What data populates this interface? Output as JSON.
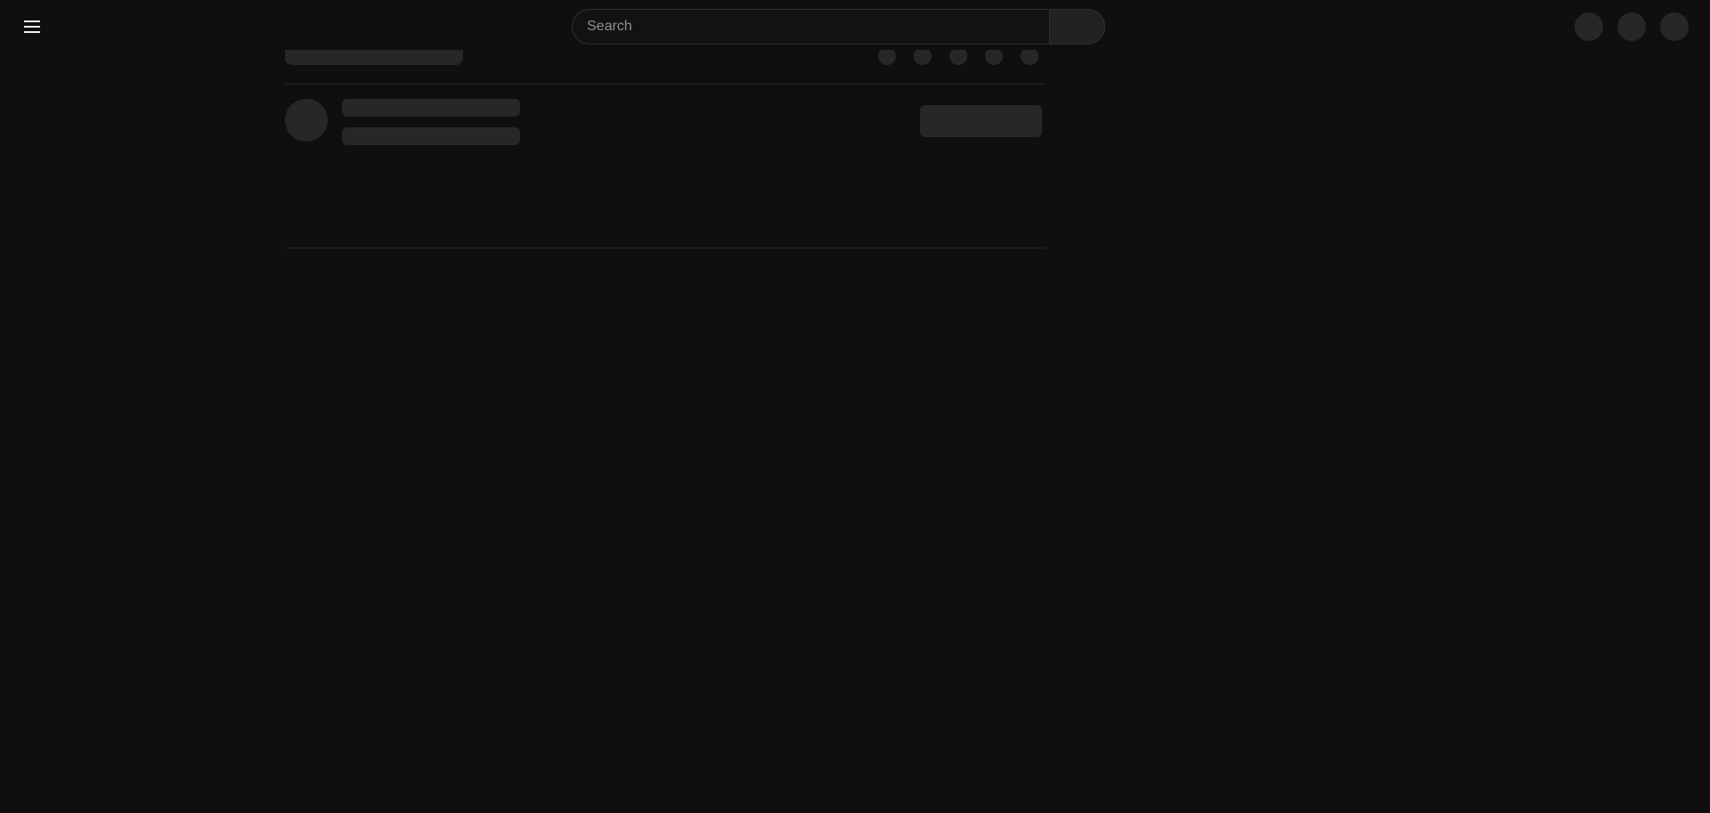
{
  "app": {
    "theme": "dark",
    "state": "loading-skeleton"
  },
  "header": {
    "menu_icon": "hamburger-menu-icon",
    "search": {
      "placeholder": "Search",
      "value": ""
    },
    "search_button_icon": "search-icon",
    "right_placeholders": [
      "skeleton-circle",
      "skeleton-circle",
      "skeleton-circle"
    ]
  },
  "content": {
    "title_placeholder": "skeleton-bar",
    "action_placeholders": 5,
    "channel_row": {
      "avatar": "skeleton-circle",
      "lines": 2,
      "button": "skeleton-button"
    }
  },
  "colors": {
    "background": "#0f0f0f",
    "skeleton": "#272727",
    "border": "#303030",
    "text": "#f1f1f1",
    "placeholder": "#8f8f8f"
  }
}
